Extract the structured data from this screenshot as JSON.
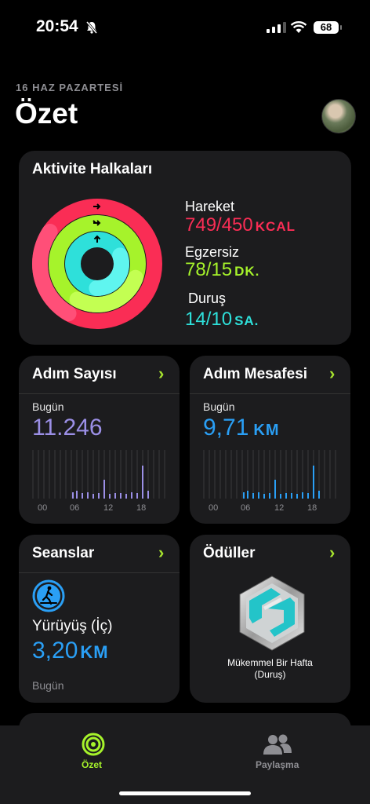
{
  "status": {
    "time": "20:54",
    "battery": "68"
  },
  "header": {
    "date": "16 HAZ PAZARTESİ",
    "title": "Özet"
  },
  "activity": {
    "title": "Aktivite Halkaları",
    "move": {
      "label": "Hareket",
      "value": "749/450",
      "unit": "KCAL",
      "color": "#fa2d55"
    },
    "exercise": {
      "label": "Egzersiz",
      "value": "78/15",
      "unit": "DK.",
      "color": "#a6f32b"
    },
    "stand": {
      "label": "Duruş",
      "value": "14/10",
      "unit": "SA.",
      "color": "#2ee0da"
    }
  },
  "steps": {
    "title": "Adım Sayısı",
    "today_label": "Bugün",
    "value": "11.246",
    "color": "#9b8fe6",
    "axis": [
      "00",
      "06",
      "12",
      "18"
    ]
  },
  "distance": {
    "title": "Adım Mesafesi",
    "today_label": "Bugün",
    "value": "9,71",
    "unit": "KM",
    "color": "#2a9ff5",
    "axis": [
      "00",
      "06",
      "12",
      "18"
    ]
  },
  "sessions": {
    "title": "Seanslar",
    "workout": "Yürüyüş (İç)",
    "value": "3,20",
    "unit": "KM",
    "when": "Bugün"
  },
  "awards": {
    "title": "Ödüller",
    "badge_line1": "Mükemmel Bir Hafta",
    "badge_line2": "(Duruş)"
  },
  "tabs": [
    {
      "label": "Özet",
      "active": true
    },
    {
      "label": "Paylaşma",
      "active": false
    }
  ]
}
